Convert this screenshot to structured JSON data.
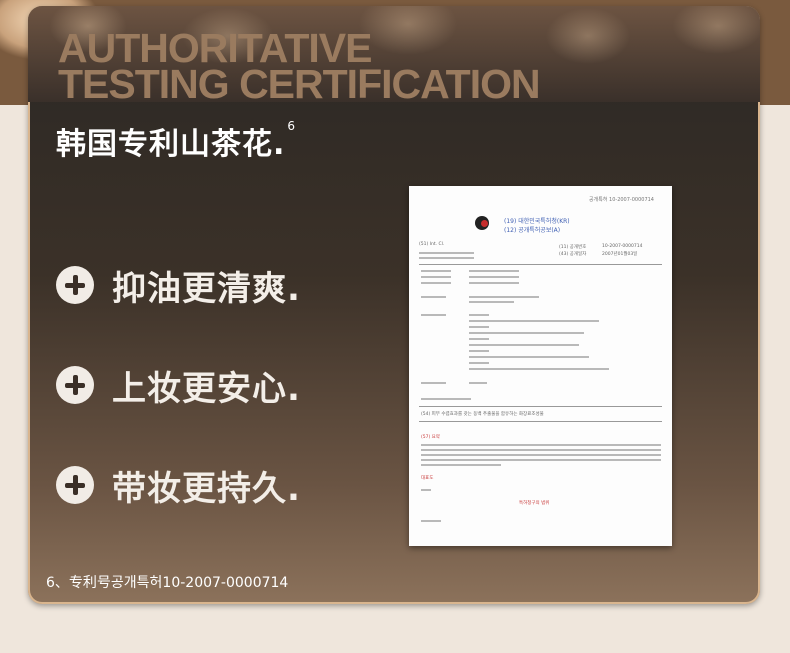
{
  "header": {
    "eng_title_line1": "AUTHORITATIVE",
    "eng_title_line2": "TESTING CERTIFICATION",
    "cn_title": "韩国专利山茶花.",
    "cn_title_sup": "6"
  },
  "features": [
    {
      "label": "抑油更清爽.",
      "icon": "plus-circle-icon"
    },
    {
      "label": "上妆更安心.",
      "icon": "plus-circle-icon"
    },
    {
      "label": "带妆更持久.",
      "icon": "plus-circle-icon"
    }
  ],
  "footnote": "6、专利号공개특허10-2007-0000714",
  "document": {
    "pub_no": "공개특허 10-2007-0000714",
    "office": "(19) 대한민국특허청(KR)",
    "doc_type": "(12) 공개특허공보(A)",
    "int_cl": "(51) Int. Cl.",
    "pub_number_label": "(11) 공개번호",
    "pub_number": "10-2007-0000714",
    "pub_date_label": "(43) 공개일자",
    "pub_date": "2007년01월03일",
    "abstract_title": "(54) 피부 수렴효과를 갖는 동백 추출물을 함유하는 화장료조성물",
    "abstract_label": "(57) 요약",
    "rep_fig": "대표도",
    "claims": "특허청구의 범위"
  },
  "colors": {
    "eng_title": "#9a7b5f",
    "accent_border": "#d9b58e",
    "doc_blue": "#3f5fb3",
    "doc_red": "#c83a3a"
  }
}
